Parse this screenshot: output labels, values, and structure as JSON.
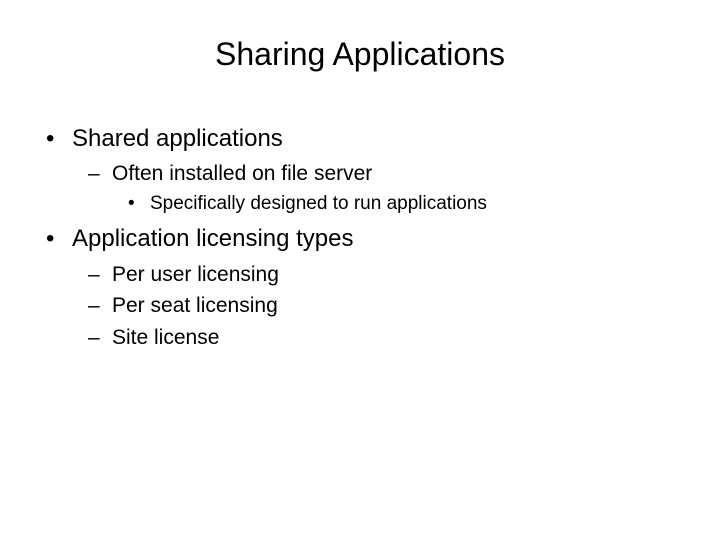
{
  "title": "Sharing Applications",
  "bullets": [
    {
      "text": "Shared applications",
      "children": [
        {
          "text": "Often installed on file server",
          "children": [
            {
              "text": "Specifically designed to run applications"
            }
          ]
        }
      ]
    },
    {
      "text": "Application licensing types",
      "children": [
        {
          "text": "Per user licensing"
        },
        {
          "text": "Per seat licensing"
        },
        {
          "text": "Site license"
        }
      ]
    }
  ]
}
